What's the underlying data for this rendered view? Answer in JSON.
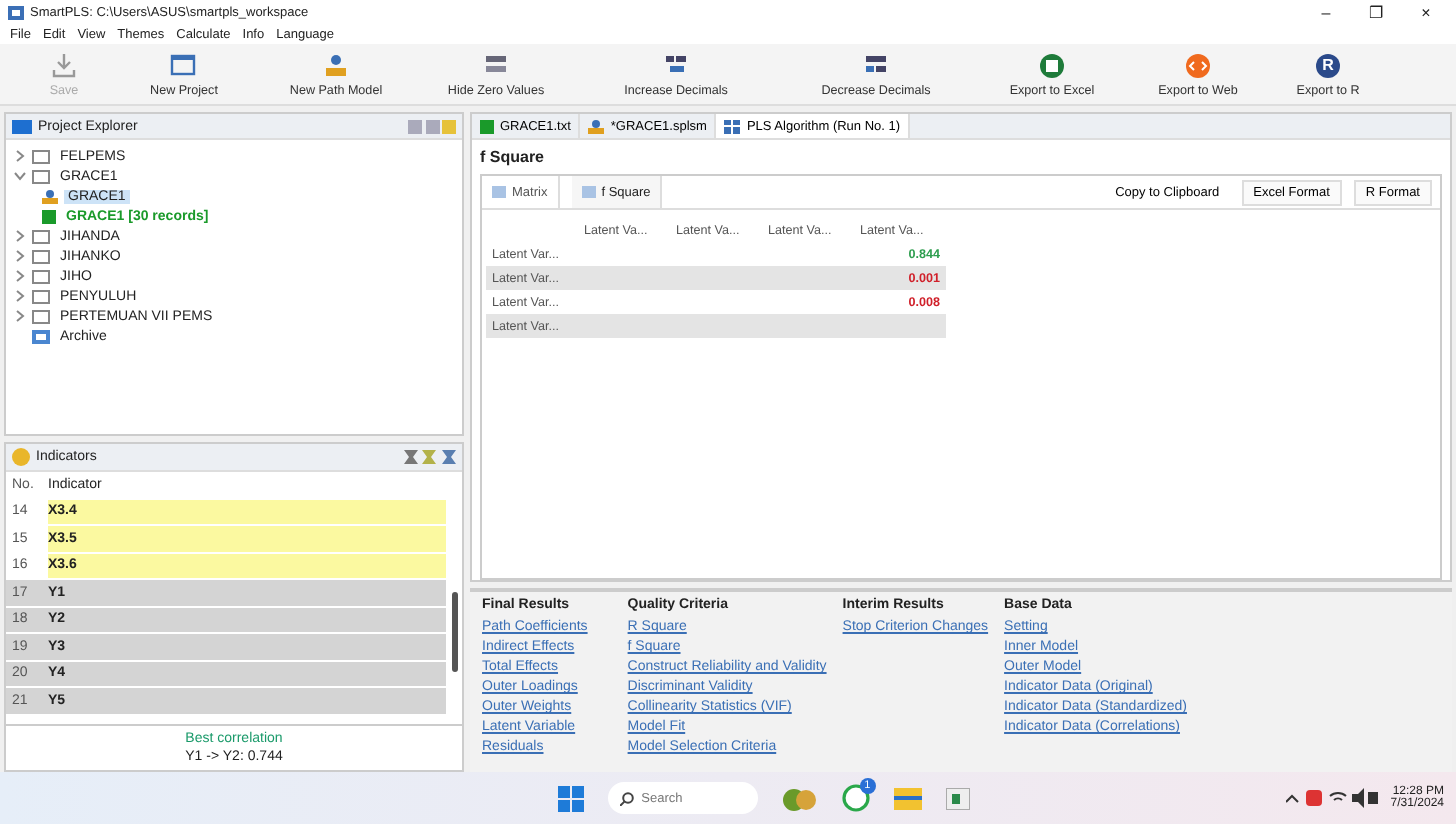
{
  "window": {
    "title": "SmartPLS: C:\\Users\\ASUS\\smartpls_workspace",
    "controls": [
      "–",
      "❐",
      "×"
    ]
  },
  "menu": [
    "File",
    "Edit",
    "View",
    "Themes",
    "Calculate",
    "Info",
    "Language"
  ],
  "toolbar": [
    {
      "label": "Save",
      "kind": "save",
      "disabled": true
    },
    {
      "label": "New Project",
      "kind": "project",
      "disabled": false
    },
    {
      "label": "New Path Model",
      "kind": "model",
      "disabled": false
    },
    {
      "label": "Hide Zero Values",
      "kind": "zero",
      "disabled": false
    },
    {
      "label": "Increase Decimals",
      "kind": "inc",
      "disabled": false
    },
    {
      "label": "Decrease Decimals",
      "kind": "dec",
      "disabled": false
    },
    {
      "label": "Export to Excel",
      "kind": "excel",
      "disabled": false
    },
    {
      "label": "Export to Web",
      "kind": "web",
      "disabled": false
    },
    {
      "label": "Export to R",
      "kind": "r",
      "disabled": false,
      "glyph": "R"
    }
  ],
  "explorer": {
    "title": "Project Explorer",
    "items": [
      {
        "label": "FELPEMS",
        "kind": "project",
        "expanded": false,
        "selected": false
      },
      {
        "label": "GRACE1",
        "kind": "project",
        "expanded": true,
        "selected": false,
        "children": [
          {
            "label": "GRACE1",
            "kind": "model",
            "selected": true
          },
          {
            "label": "GRACE1 [30 records]",
            "kind": "data",
            "selected": false
          }
        ]
      },
      {
        "label": "JIHANDA",
        "kind": "project",
        "expanded": false,
        "selected": false
      },
      {
        "label": "JIHANKO",
        "kind": "project",
        "expanded": false,
        "selected": false
      },
      {
        "label": "JIHO",
        "kind": "project",
        "expanded": false,
        "selected": false
      },
      {
        "label": "PENYULUH",
        "kind": "project",
        "expanded": false,
        "selected": false
      },
      {
        "label": "PERTEMUAN VII PEMS",
        "kind": "project",
        "expanded": false,
        "selected": false
      },
      {
        "label": "Archive",
        "kind": "archive",
        "selected": false
      }
    ]
  },
  "indicators": {
    "title": "Indicators",
    "columns": [
      "No.",
      "Indicator"
    ],
    "rows": [
      {
        "no": "14",
        "name": "X3.4",
        "highlighted": true
      },
      {
        "no": "15",
        "name": "X3.5",
        "highlighted": true
      },
      {
        "no": "16",
        "name": "X3.6",
        "highlighted": true
      },
      {
        "no": "17",
        "name": "Y1",
        "highlighted": false
      },
      {
        "no": "18",
        "name": "Y2",
        "highlighted": false
      },
      {
        "no": "19",
        "name": "Y3",
        "highlighted": false
      },
      {
        "no": "20",
        "name": "Y4",
        "highlighted": false
      },
      {
        "no": "21",
        "name": "Y5",
        "highlighted": false
      }
    ],
    "footer_title": "Best correlation",
    "footer_value": "Y1 -> Y2: 0.744"
  },
  "editor_tabs": [
    {
      "label": "GRACE1.txt",
      "kind": "data",
      "selected": false
    },
    {
      "label": "*GRACE1.splsm",
      "kind": "model",
      "selected": false
    },
    {
      "label": "PLS Algorithm (Run No. 1)",
      "kind": "report",
      "selected": true
    }
  ],
  "report": {
    "title": "f Square",
    "views": [
      {
        "label": "Matrix",
        "selected": false
      },
      {
        "label": "f Square",
        "selected": true
      }
    ],
    "actions": [
      "Copy to Clipboard",
      "Excel Format",
      "R Format"
    ],
    "table": {
      "columns": [
        "Latent Va...",
        "Latent Va...",
        "Latent Va...",
        "Latent Va..."
      ],
      "rows": [
        {
          "label": "Latent Var...",
          "cells": [
            null,
            null,
            null,
            {
              "text": "0.844",
              "color": "#2e9e4f"
            }
          ]
        },
        {
          "label": "Latent Var...",
          "cells": [
            null,
            null,
            null,
            {
              "text": "0.001",
              "color": "#d0202a"
            }
          ]
        },
        {
          "label": "Latent Var...",
          "cells": [
            null,
            null,
            null,
            {
              "text": "0.008",
              "color": "#d0202a"
            }
          ]
        },
        {
          "label": "Latent Var...",
          "cells": [
            null,
            null,
            null,
            null
          ]
        }
      ]
    }
  },
  "results": [
    {
      "heading": "Final Results",
      "links": [
        "Path Coefficients",
        "Indirect Effects",
        "Total Effects",
        "Outer Loadings",
        "Outer Weights",
        "Latent Variable",
        "Residuals"
      ]
    },
    {
      "heading": "Quality Criteria",
      "links": [
        "R Square",
        "f Square",
        "Construct Reliability and Validity",
        "Discriminant Validity",
        "Collinearity Statistics (VIF)",
        "Model Fit",
        "Model Selection Criteria"
      ]
    },
    {
      "heading": "Interim Results",
      "links": [
        "Stop Criterion Changes"
      ]
    },
    {
      "heading": "Base Data",
      "links": [
        "Setting",
        "Inner Model",
        "Outer Model",
        "Indicator Data (Original)",
        "Indicator Data (Standardized)",
        "Indicator Data (Correlations)"
      ]
    }
  ],
  "taskbar": {
    "search_placeholder": "Search",
    "badge": "1",
    "time": "12:28 PM",
    "date": "7/31/2024"
  }
}
